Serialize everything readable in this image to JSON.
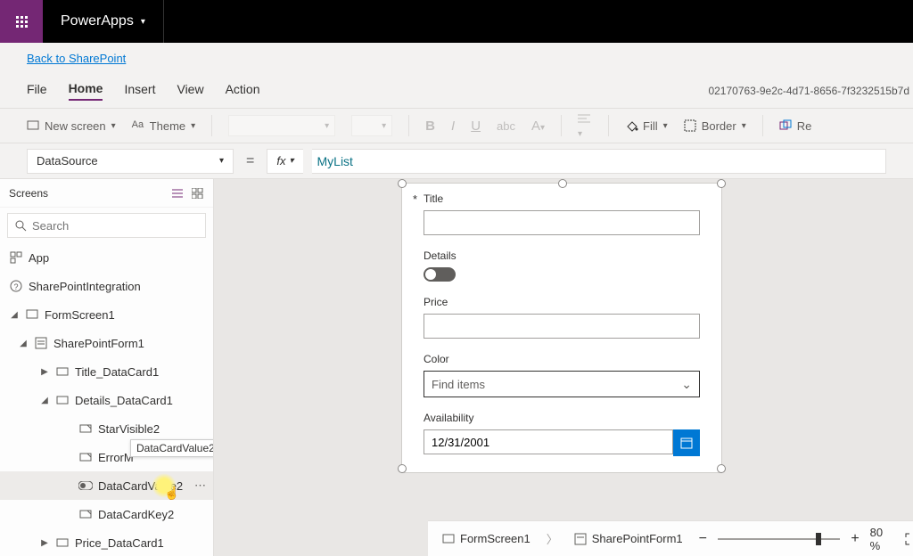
{
  "header": {
    "app_name": "PowerApps"
  },
  "back_link": "Back to SharePoint",
  "menu": {
    "file": "File",
    "home": "Home",
    "insert": "Insert",
    "view": "View",
    "action": "Action"
  },
  "file_id": "02170763-9e2c-4d71-8656-7f3232515b7d",
  "toolbar": {
    "new_screen": "New screen",
    "theme": "Theme",
    "fill": "Fill",
    "border": "Border",
    "reorder": "Re"
  },
  "property_bar": {
    "selected_property": "DataSource",
    "formula": "MyList"
  },
  "sidebar": {
    "title": "Screens",
    "search_placeholder": "Search",
    "items": [
      {
        "label": "App"
      },
      {
        "label": "SharePointIntegration"
      },
      {
        "label": "FormScreen1"
      },
      {
        "label": "SharePointForm1"
      },
      {
        "label": "Title_DataCard1"
      },
      {
        "label": "Details_DataCard1"
      },
      {
        "label": "StarVisible2"
      },
      {
        "label": "ErrorM"
      },
      {
        "label": "DataCardValue2"
      },
      {
        "label": "DataCardKey2"
      },
      {
        "label": "Price_DataCard1"
      }
    ],
    "tooltip": "DataCardValue2"
  },
  "form": {
    "title_label": "Title",
    "details_label": "Details",
    "price_label": "Price",
    "color_label": "Color",
    "color_placeholder": "Find items",
    "availability_label": "Availability",
    "availability_value": "12/31/2001"
  },
  "breadcrumb": {
    "screen": "FormScreen1",
    "form": "SharePointForm1"
  },
  "zoom": {
    "percent": "80 %"
  }
}
